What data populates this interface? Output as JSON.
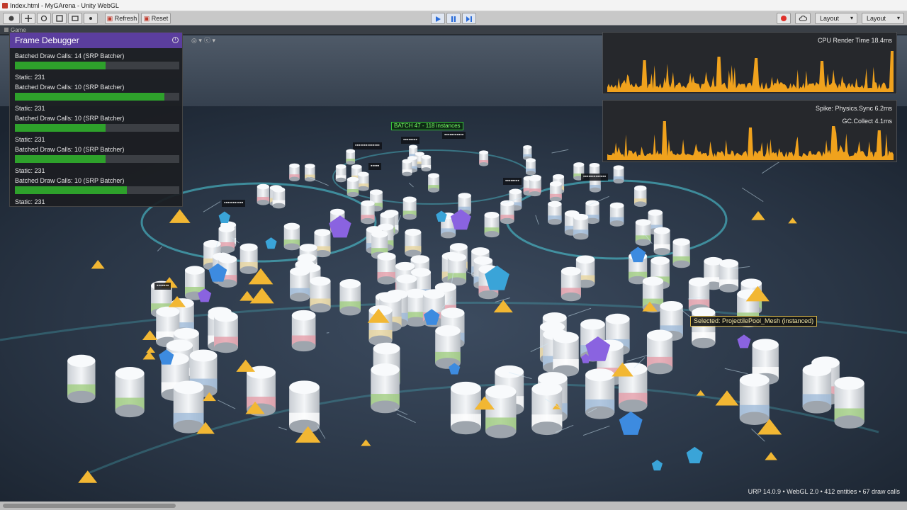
{
  "window": {
    "title": "Index.html - MyGArena - Unity WebGL"
  },
  "toolbar": {
    "refresh_label": "Refresh",
    "reset_label": "Reset",
    "layout_dropdown_1": "Layout",
    "layout_dropdown_2": "Layout"
  },
  "scene_tab": {
    "label": "Game"
  },
  "frame_debugger": {
    "title": "Frame Debugger",
    "batches": [
      {
        "label": "Batched Draw Calls: 14 (SRP Batcher)",
        "fill": 0.55,
        "static": "Static: 231"
      },
      {
        "label": "Batched Draw Calls: 10 (SRP Batcher)",
        "fill": 0.91,
        "static": "Static: 231"
      },
      {
        "label": "Batched Draw Calls: 10 (SRP Batcher)",
        "fill": 0.55,
        "static": "Static: 231"
      },
      {
        "label": "Batched Draw Calls: 10 (SRP Batcher)",
        "fill": 0.55,
        "static": "Static: 231"
      },
      {
        "label": "Batched Draw Calls: 10 (SRP Batcher)",
        "fill": 0.68,
        "static": "Static: 231"
      }
    ]
  },
  "cpu_graph": {
    "label": "CPU Render Time 18.4ms",
    "color": "#f0a21d"
  },
  "spike_graph": {
    "label1": "Spike: Physics.Sync 6.2ms",
    "label2": "GC.Collect 4.1ms",
    "color": "#f0a21d"
  },
  "scene_labels": {
    "batch_tag": "BATCH 47 - 118 instances",
    "selected": "Selected: ProjectilePool_Mesh (instanced)"
  },
  "footer": {
    "status": "URP 14.0.9 • WebGL 2.0 • 412 entities • 67 draw calls"
  },
  "colors": {
    "accent_purple": "#5b3e9e",
    "bar_green": "#2ea12b",
    "graph_orange": "#f0a21d",
    "ring_cyan": "#4fd2e0"
  }
}
